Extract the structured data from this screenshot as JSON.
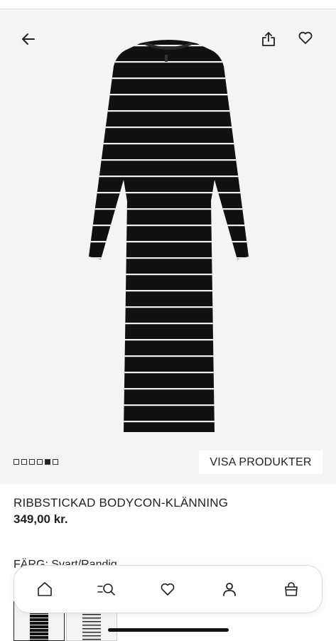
{
  "header": {
    "back_icon": "arrow-left-icon",
    "share_icon": "share-icon",
    "favorite_icon": "heart-icon"
  },
  "gallery": {
    "cta_label": "VISA PRODUKTER",
    "image_count": 6,
    "active_index": 4
  },
  "product": {
    "title": "RIBBSTICKAD BODYCON-KLÄNNING",
    "price": "349,00 kr.",
    "color_label": "FÄRG: Svart/Randig"
  },
  "swatches": [
    {
      "name": "black-striped",
      "selected": true
    },
    {
      "name": "white-striped",
      "selected": false
    }
  ],
  "bottom_nav": {
    "items": [
      {
        "icon": "home-icon"
      },
      {
        "icon": "search-menu-icon"
      },
      {
        "icon": "heart-icon"
      },
      {
        "icon": "user-icon"
      },
      {
        "icon": "shopping-bag-icon"
      }
    ]
  },
  "colors": {
    "hero_background": "#f4f4f4",
    "dress": "#111111",
    "stripe": "#f2f2f2",
    "text": "#222222"
  }
}
